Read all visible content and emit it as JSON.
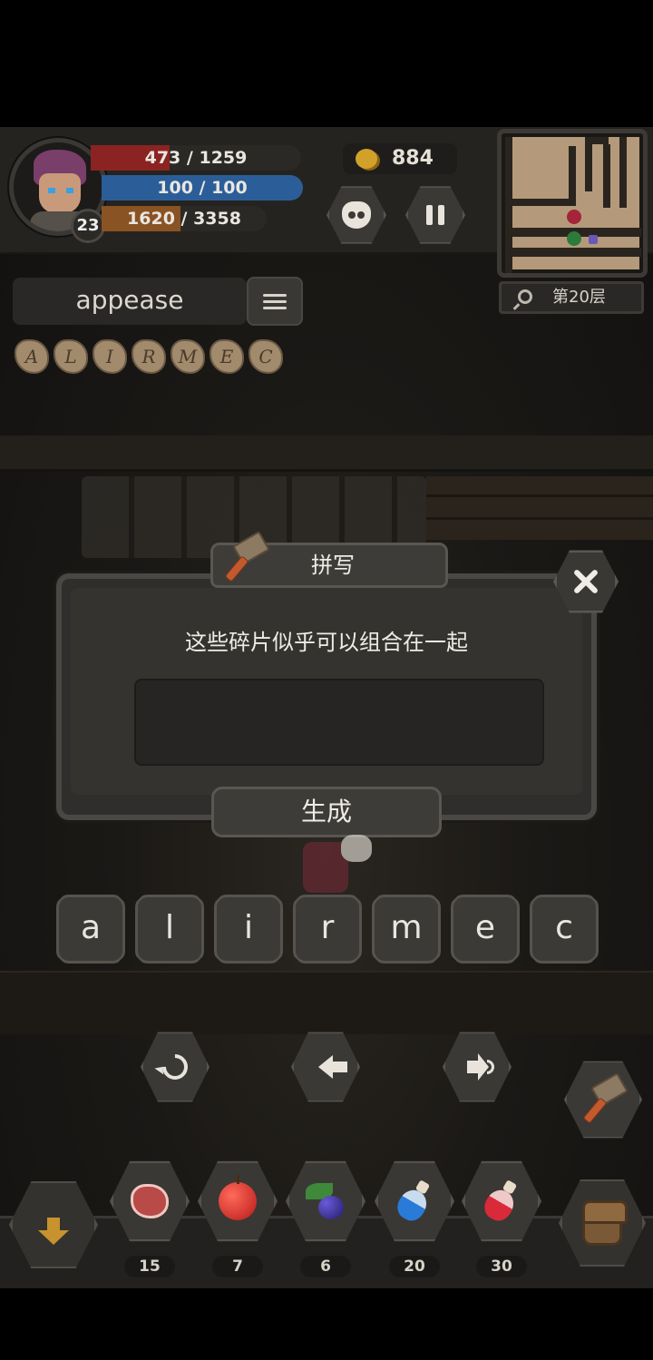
{
  "hud": {
    "level": "23",
    "hp": {
      "current": 473,
      "max": 1259,
      "text_current": "473",
      "sep": "/",
      "text_max": "1259",
      "color": "#8b2322"
    },
    "mp": {
      "text": "100 / 100",
      "fraction": 1.0,
      "color": "#2b5e98"
    },
    "xp": {
      "text": "1620 / 3358",
      "fraction": 0.48,
      "color": "#8a5324"
    },
    "gold": "884",
    "floor": "第20层"
  },
  "word_panel": {
    "current_word": "appease",
    "fragments": [
      "A",
      "L",
      "I",
      "R",
      "M",
      "E",
      "C"
    ]
  },
  "dialog": {
    "title": "拼写",
    "message": "这些碎片似乎可以组合在一起",
    "answer_value": "",
    "generate_label": "生成"
  },
  "letters": [
    "a",
    "l",
    "i",
    "r",
    "m",
    "e",
    "c"
  ],
  "controls": {
    "reset": "reset-icon",
    "backspace": "backspace-arrow-icon",
    "sound": "speaker-icon"
  },
  "inventory": [
    {
      "name": "meat",
      "count": "15"
    },
    {
      "name": "apple",
      "count": "7"
    },
    {
      "name": "berries",
      "count": "6"
    },
    {
      "name": "blue-potion",
      "count": "20"
    },
    {
      "name": "red-potion",
      "count": "30"
    }
  ]
}
